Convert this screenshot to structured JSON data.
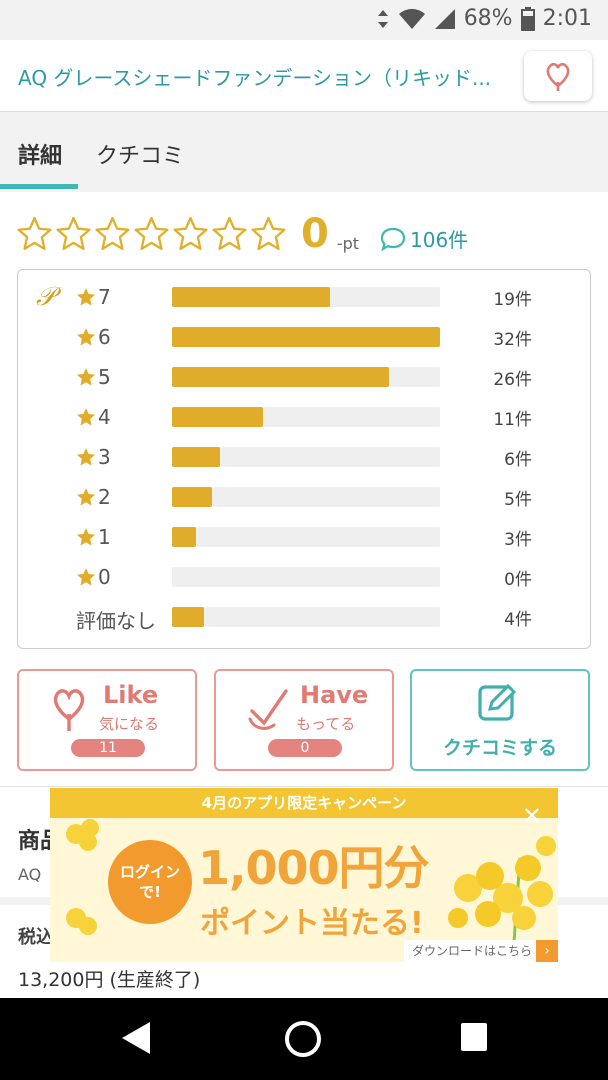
{
  "status": {
    "battery": "68%",
    "time": "2:01"
  },
  "header": {
    "title": "AQ グレースシェードファンデーション（リキッド..."
  },
  "tabs": [
    {
      "label": "詳細"
    },
    {
      "label": "クチコミ"
    }
  ],
  "rating": {
    "score": "0",
    "unit": "-pt",
    "review_count": "106件"
  },
  "distribution": [
    {
      "label": "7",
      "count": "19件",
      "fraction": 0.59
    },
    {
      "label": "6",
      "count": "32件",
      "fraction": 1.0
    },
    {
      "label": "5",
      "count": "26件",
      "fraction": 0.81
    },
    {
      "label": "4",
      "count": "11件",
      "fraction": 0.34
    },
    {
      "label": "3",
      "count": "6件",
      "fraction": 0.18
    },
    {
      "label": "2",
      "count": "5件",
      "fraction": 0.15
    },
    {
      "label": "1",
      "count": "3件",
      "fraction": 0.09
    },
    {
      "label": "0",
      "count": "0件",
      "fraction": 0.0
    },
    {
      "label": "評価なし",
      "count": "4件",
      "fraction": 0.12
    }
  ],
  "buttons": {
    "like": {
      "title": "Like",
      "sub": "気になる",
      "count": "11"
    },
    "have": {
      "title": "Have",
      "sub": "もってる",
      "count": "0"
    },
    "review": {
      "label": "クチコミする"
    }
  },
  "product": {
    "heading": "商品",
    "sub": "AQ",
    "tax_label": "税込",
    "price": "13,200円 (生産終了)"
  },
  "banner": {
    "top": "4月のアプリ限定キャンペーン",
    "bubble_line1": "ログイン",
    "bubble_line2": "で!",
    "amount": "1,000円分",
    "message": "ポイント当たる!",
    "download": "ダウンロードはこちら"
  },
  "colors": {
    "accent_teal": "#3fb8b4",
    "gold": "#e0ac2a",
    "pink": "#e07a72"
  }
}
